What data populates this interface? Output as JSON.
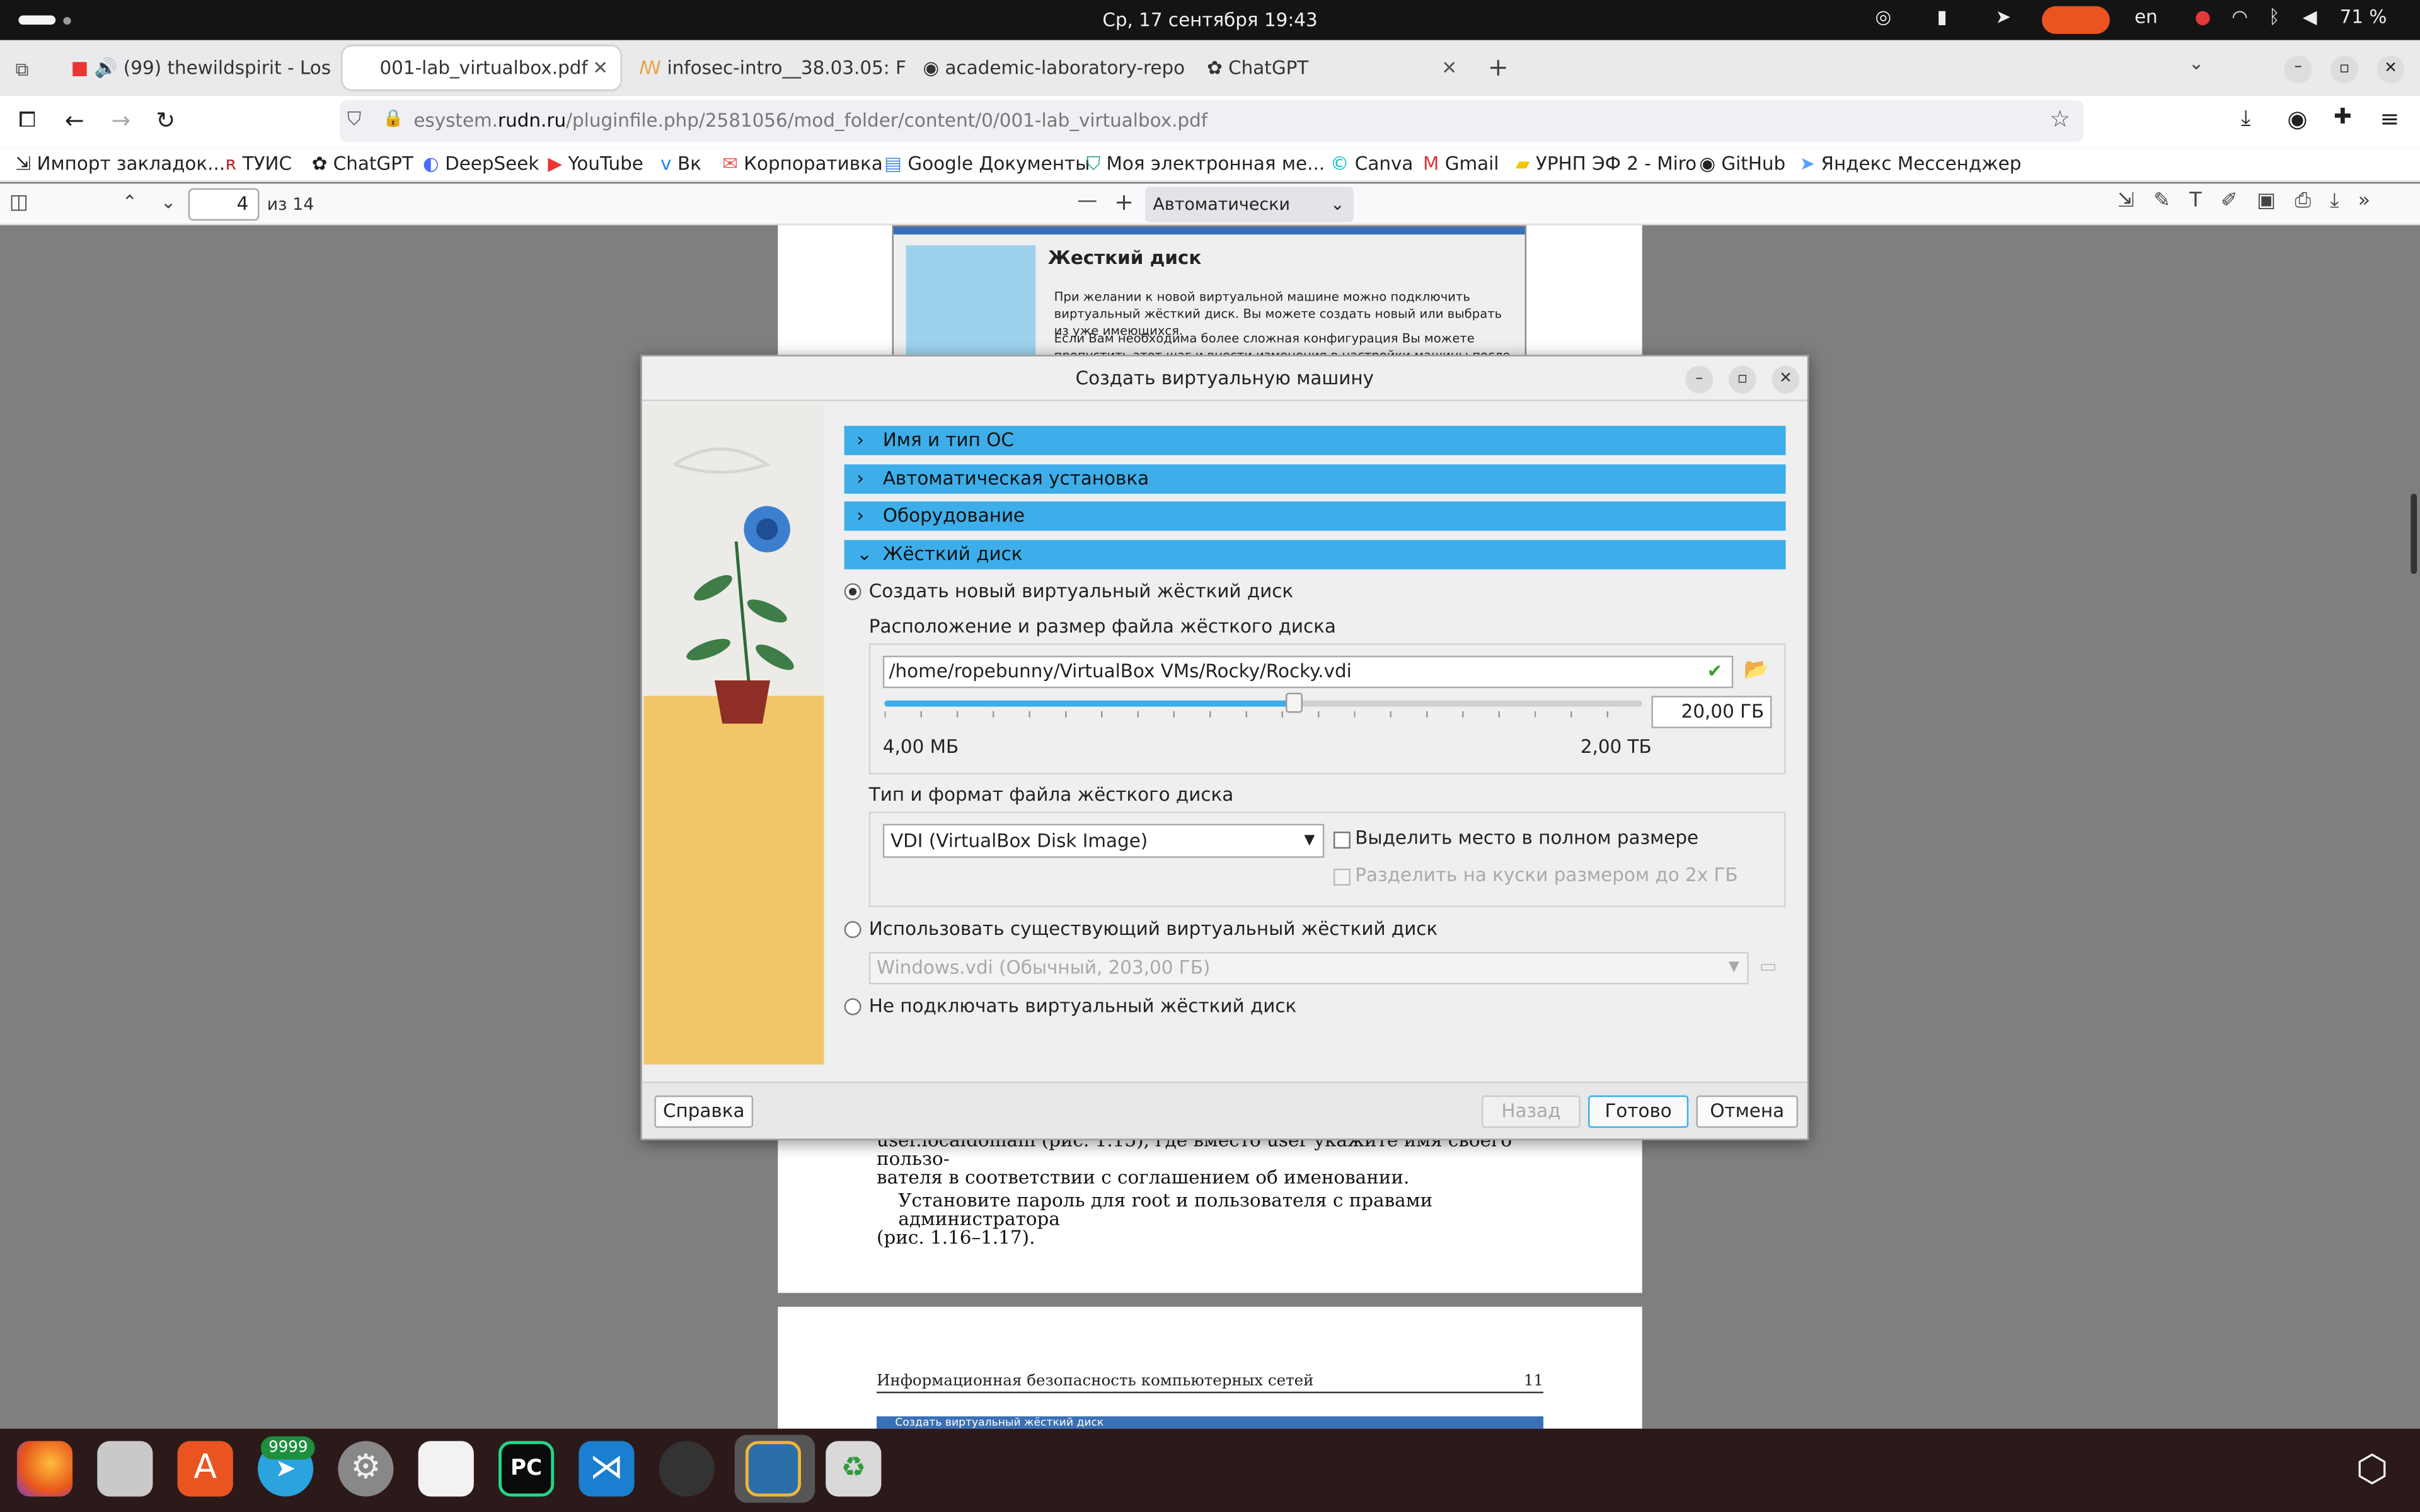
{
  "system": {
    "datetime": "Ср, 17 сентября  19:43",
    "lang": "en",
    "battery": "71 %"
  },
  "browser": {
    "tabs": [
      {
        "label": "(99) thewildspirit - Los"
      },
      {
        "label": "001-lab_virtualbox.pdf"
      },
      {
        "label": "infosec-intro__38.03.05: F"
      },
      {
        "label": "academic-laboratory-repo"
      },
      {
        "label": "ChatGPT"
      }
    ],
    "url": {
      "prefix": "esystem.",
      "domain": "rudn.ru",
      "path": "/pluginfile.php/2581056/mod_folder/content/0/001-lab_virtualbox.pdf"
    },
    "bookmarks": [
      "Импорт закладок...",
      "ТУИС",
      "ChatGPT",
      "DeepSeek",
      "YouTube",
      "Вк",
      "Корпоративка",
      "Google Документы",
      "Моя электронная ме...",
      "Canva",
      "Gmail",
      "УРНП ЭФ 2 - Miro",
      "GitHub",
      "Яндекс Мессенджер"
    ]
  },
  "pdf": {
    "page_current": "4",
    "page_total": "из 14",
    "zoom": "Автоматически",
    "bg_dialog_title": "Жесткий диск",
    "bg_dialog_p1": "При желании к новой виртуальной машине можно подключить виртуальный жёсткий диск. Вы можете создать новый или выбрать из уже имеющихся.",
    "bg_dialog_p2": "Если Вам необходима более сложная конфигурация Вы можете пропустить этот шаг и внести изменения в настройки машины после её создания.",
    "text_line1": "user.localdomain (рис. 1.15), где вместо user укажите имя своего пользо-",
    "text_line2": "вателя в соответствии с соглашением об именовании.",
    "text_line3": "Установите пароль для root и пользователя с правами администратора",
    "text_line4": "(рис. 1.16–1.17).",
    "header_left": "Информационная безопасность компьютерных сетей",
    "header_right": "11",
    "next_caption": "Создать виртуальный жёсткий диск"
  },
  "dialog": {
    "title": "Создать виртуальную машину",
    "sections": [
      "Имя и тип ОС",
      "Автоматическая установка",
      "Оборудование",
      "Жёсткий диск"
    ],
    "opt_create": "Создать новый виртуальный жёсткий диск",
    "location_label": "Расположение и размер файла жёсткого диска",
    "path": "/home/ropebunny/VirtualBox VMs/Rocky/Rocky.vdi",
    "size": "20,00 ГБ",
    "size_fraction": 0.54,
    "min": "4,00 МБ",
    "max": "2,00 ТБ",
    "type_label": "Тип и формат файла жёсткого диска",
    "type_value": "VDI (VirtualBox Disk Image)",
    "chk_full": "Выделить место в полном размере",
    "chk_split": "Разделить на куски размером до 2х ГБ",
    "opt_existing": "Использовать существующий виртуальный жёсткий диск",
    "existing_value": "Windows.vdi (Обычный, 203,00 ГБ)",
    "opt_none": "Не подключать виртуальный жёсткий диск",
    "btn_help": "Справка",
    "btn_back": "Назад",
    "btn_done": "Готово",
    "btn_cancel": "Отмена"
  },
  "dock": {
    "telegram_badge": "9999"
  }
}
